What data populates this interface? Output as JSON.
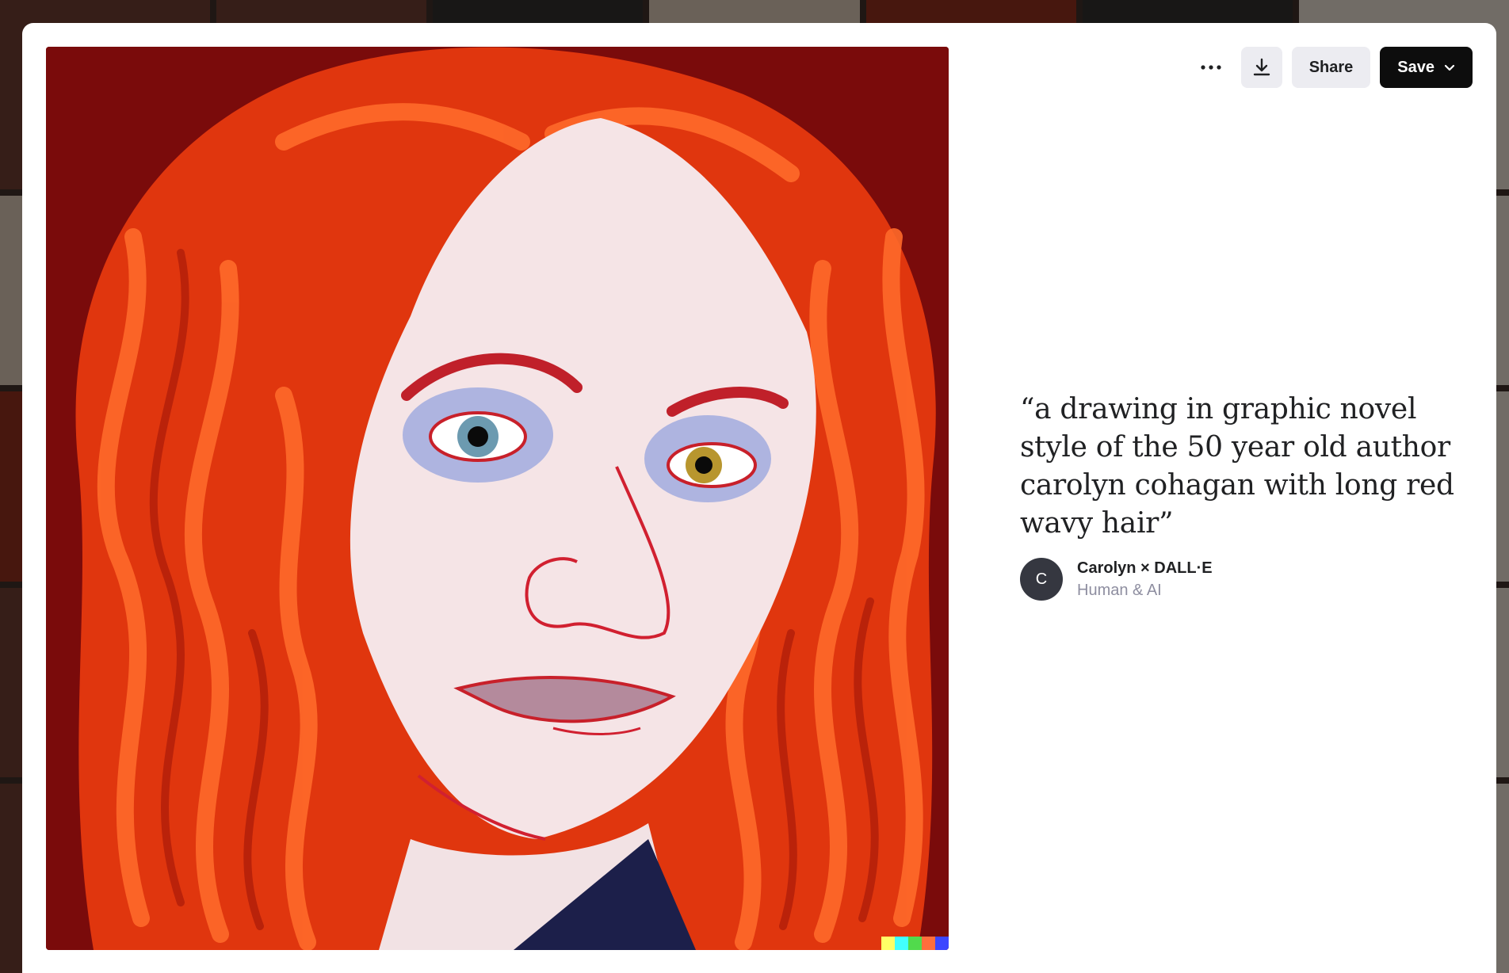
{
  "modal": {
    "toolbar": {
      "more_icon": "more-horizontal-icon",
      "download_icon": "download-icon",
      "share_label": "Share",
      "save_label": "Save",
      "save_chevron_icon": "chevron-down-icon"
    },
    "image": {
      "subject_icon": "generated-portrait-image",
      "signature_colors": [
        "#ffff66",
        "#42ffff",
        "#51da4c",
        "#ff6e3c",
        "#3c46ff"
      ]
    },
    "prompt": "“a drawing in graphic novel style of the 50 year old author carolyn cohagan with long red wavy hair”",
    "author": {
      "avatar_initial": "C",
      "name": "Carolyn × DALL·E",
      "subtitle": "Human & AI"
    }
  },
  "colors": {
    "save_button_bg": "#0d0d0d",
    "secondary_button_bg": "#ececf1",
    "hair": "#ff4a12",
    "background_red": "#7a0b0b"
  }
}
